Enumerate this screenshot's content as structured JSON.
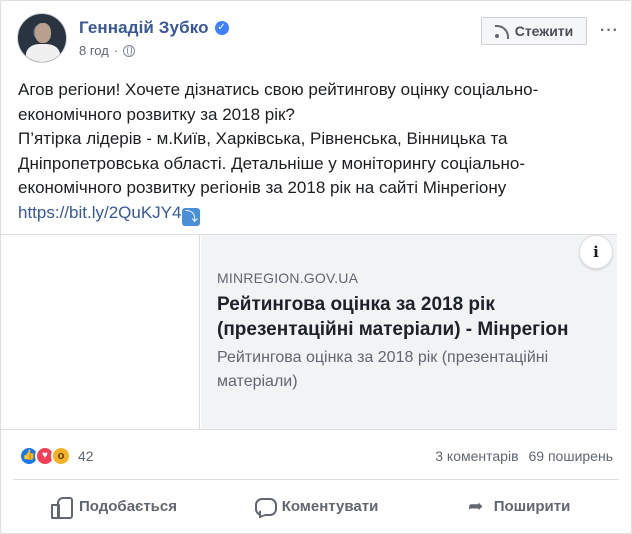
{
  "post": {
    "author": "Геннадій Зубко",
    "time": "8 год",
    "follow_label": "Стежити",
    "text_lines": [
      "Агов регіони! Хочете дізнатись свою рейтингову оцінку соціально-",
      "економічного розвитку за 2018 рік?",
      "П’ятірка лідерів - м.Київ, Харківська, Рівненська, Вінницька та",
      "Дніпропетровська області. Детальніше у моніторингу соціально-",
      "економічного розвитку регіонів за 2018 рік на сайті Мінрегіону"
    ],
    "link": "https://bit.ly/2QuKJY4"
  },
  "preview": {
    "domain": "MINREGION.GOV.UA",
    "title_lines": [
      "Рейтингова оцінка за 2018 рік",
      "(презентаційні матеріали) - Мінрегіон"
    ],
    "description_lines": [
      "Рейтингова оцінка за 2018 рік (презентаційні",
      "матеріали)"
    ],
    "info_label": "i"
  },
  "stats": {
    "reaction_count": "42",
    "comments": "3 коментарів",
    "shares": "69 поширень"
  },
  "actions": {
    "like": "Подобається",
    "comment": "Коментувати",
    "share": "Поширити"
  },
  "icons": {
    "verified": "verified-badge-icon",
    "globe": "globe-icon",
    "rss": "rss-icon",
    "more": "more-options-icon",
    "arrow": "arrow-down-right-emoji"
  },
  "colors": {
    "link": "#385898",
    "like": "#1877f2",
    "love": "#f33e58",
    "wow": "#f7b125"
  }
}
